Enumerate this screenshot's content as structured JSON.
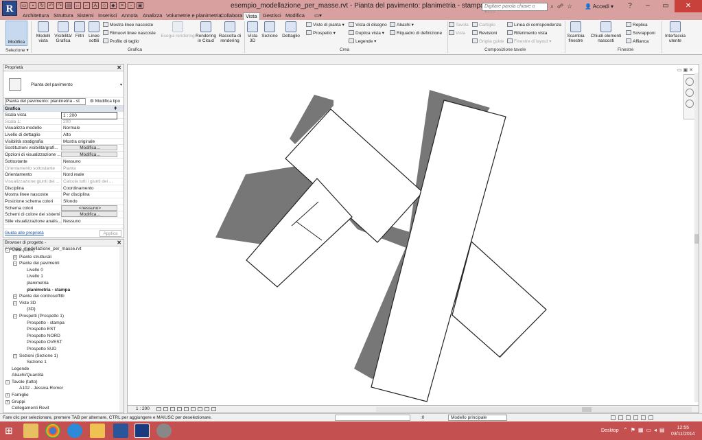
{
  "window": {
    "title": "esempio_modellazione_per_masse.rvt - Pianta del pavimento: planimetria - stampa",
    "search_placeholder": "Digitare parola chiave o frase",
    "user": "Accedi",
    "logo_letter": "R"
  },
  "tabs": [
    "Architettura",
    "Struttura",
    "Sistemi",
    "Inserisci",
    "Annota",
    "Analizza",
    "Volumetrie e planimetria",
    "Collabora",
    "Vista",
    "Gestisci",
    "Modifica"
  ],
  "active_tab": "Vista",
  "ribbon": {
    "modifica": "Modifica",
    "selezione": "Selezione",
    "grafica_title": "Grafica",
    "crea_title": "Crea",
    "composizione_title": "Composizione tavole",
    "finestre_title": "Finestre",
    "modelli_vista": "Modelli vista",
    "visibilita": "Visibilità/ Grafica",
    "filtri": "Filtri",
    "linee_sottili": "Linee sottili",
    "mostra_linee": "Mostra linee nascoste",
    "rimuovi_linee": "Rimuovi linee nascoste",
    "profilo_taglio": "Profilo di taglio",
    "esegui_rendering": "Esegui rendering",
    "rendering_cloud": "Rendering in Cloud",
    "raccolta_rendering": "Raccolta di rendering",
    "vista_3d": "Vista 3D",
    "sezione": "Sezione",
    "dettaglio": "Dettaglio",
    "viste_pianta": "Viste di pianta",
    "prospetto": "Prospetto",
    "vista_disegno": "Vista di disegno",
    "duplica_vista": "Duplica vista",
    "legende": "Legende",
    "abachi": "Abachi",
    "riquadro_def": "Riquadro di definizione",
    "tavola": "Tavola",
    "vista": "Vista",
    "cartiglio": "Cartiglio",
    "revisioni": "Revisioni",
    "griglia_guide": "Griglia guide",
    "linea_corrispondenza": "Linea di corrispondenza",
    "riferimento_vista": "Riferimento vista",
    "finestre_layout": "Finestre di layout",
    "scambia_finestre": "Scambia finestre",
    "chiudi_nascosti": "Chiudi elementi nascosti",
    "replica": "Replica",
    "sovrapponi": "Sovrapponi",
    "affianca": "Affianca",
    "interfaccia": "Interfaccia utente"
  },
  "properties": {
    "header": "Proprietà",
    "type_name": "Pianta del pavimento",
    "instance_dropdown": "Pianta del pavimento: planimetria - st",
    "modifica_tipo": "Modifica tipo",
    "group": "Grafica",
    "rows": [
      {
        "k": "Scala vista",
        "v": "1 : 200",
        "style": "input"
      },
      {
        "k": "Scala 1:",
        "v": "200",
        "style": "gray"
      },
      {
        "k": "Visualizza modello",
        "v": "Normale"
      },
      {
        "k": "Livello di dettaglio",
        "v": "Alto"
      },
      {
        "k": "Visibilità stratigrafia",
        "v": "Mostra originale"
      },
      {
        "k": "Sostituzioni visibilità/grafi...",
        "v": "Modifica...",
        "style": "btn"
      },
      {
        "k": "Opzioni di visualizzazione ...",
        "v": "Modifica...",
        "style": "btn"
      },
      {
        "k": "Sottostante",
        "v": "Nessuno"
      },
      {
        "k": "Orientamento sottostante",
        "v": "Pianta",
        "style": "gray"
      },
      {
        "k": "Orientamento",
        "v": "Nord reale"
      },
      {
        "k": "Visualizzazione giunti dei ...",
        "v": "Calcola tutti i giunti dei ...",
        "style": "gray"
      },
      {
        "k": "Disciplina",
        "v": "Coordinamento"
      },
      {
        "k": "Mostra linee nascoste",
        "v": "Per disciplina"
      },
      {
        "k": "Posizione schema colori",
        "v": "Sfondo"
      },
      {
        "k": "Schema colori",
        "v": "<nessuno>",
        "style": "btn"
      },
      {
        "k": "Schemi di colore dei sistemi",
        "v": "Modifica...",
        "style": "btn"
      },
      {
        "k": "Stile visualizzazione analis...",
        "v": "Nessuno"
      }
    ],
    "help_link": "Guida alle proprietà",
    "apply": "Applica"
  },
  "browser": {
    "header": "Browser di progetto - esempio_modellazione_per_masse.rvt",
    "nodes": [
      {
        "label": "Viste (tutto)",
        "level": 0,
        "toggle": "−"
      },
      {
        "label": "Piante strutturali",
        "level": 1,
        "toggle": "+"
      },
      {
        "label": "Piante dei pavimenti",
        "level": 1,
        "toggle": "−"
      },
      {
        "label": "Livello 0",
        "level": 2
      },
      {
        "label": "Livello 1",
        "level": 2
      },
      {
        "label": "planimetria",
        "level": 2
      },
      {
        "label": "planimetria - stampa",
        "level": 2,
        "bold": true
      },
      {
        "label": "Piante dei controsoffitti",
        "level": 1,
        "toggle": "+"
      },
      {
        "label": "Viste 3D",
        "level": 1,
        "toggle": "−"
      },
      {
        "label": "{3D}",
        "level": 2
      },
      {
        "label": "Prospetti (Prospetto 1)",
        "level": 1,
        "toggle": "−"
      },
      {
        "label": "Prospetto - stampa",
        "level": 2
      },
      {
        "label": "Prospetto EST",
        "level": 2
      },
      {
        "label": "Prospetto NORD",
        "level": 2
      },
      {
        "label": "Prospetto OVEST",
        "level": 2
      },
      {
        "label": "Prospetto SUD",
        "level": 2
      },
      {
        "label": "Sezioni (Sezione 1)",
        "level": 1,
        "toggle": "−"
      },
      {
        "label": "Sezione 1",
        "level": 2
      },
      {
        "label": "Legende",
        "level": 0
      },
      {
        "label": "Abachi/Quantità",
        "level": 0
      },
      {
        "label": "Tavole (tutto)",
        "level": 0,
        "toggle": "−"
      },
      {
        "label": "A102 - Jessica Romor",
        "level": 1
      },
      {
        "label": "Famiglie",
        "level": 0,
        "toggle": "+"
      },
      {
        "label": "Gruppi",
        "level": 0,
        "toggle": "+"
      },
      {
        "label": "Collegamenti Revit",
        "level": 0
      }
    ]
  },
  "view": {
    "scale": "1 : 200"
  },
  "status": {
    "message": "Fare clic per selezionare, premere TAB per alternare, CTRL per aggiungere e MAIUSC per deselezionare.",
    "zero": ":0",
    "model": "Modello principale"
  },
  "taskbar": {
    "desktop": "Desktop",
    "time": "12:55",
    "date": "03/11/2014"
  },
  "colors": {
    "accent_title": "#d9a0a0",
    "taskbar": "#c4504f",
    "shadow": "#7a7a7a"
  }
}
